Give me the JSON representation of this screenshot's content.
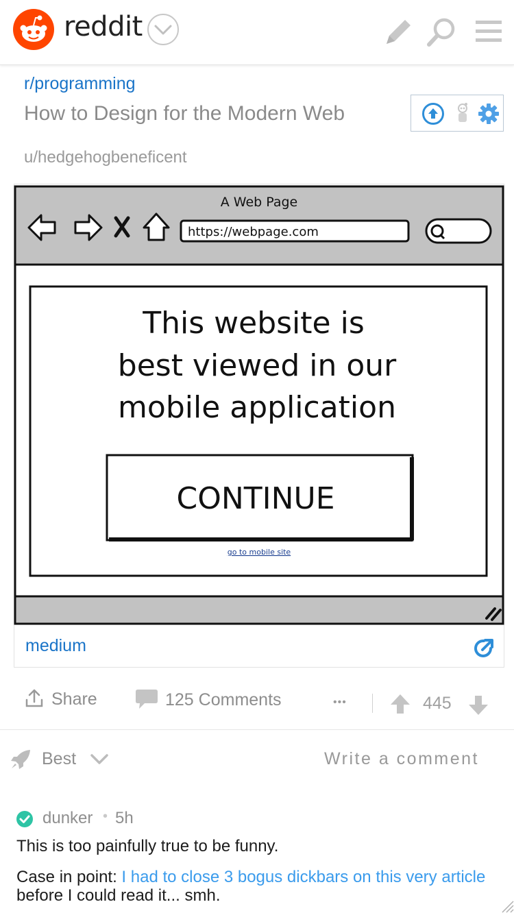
{
  "header": {
    "brand": "reddit",
    "icons": [
      "reddit-logo-icon",
      "chevron-down-icon",
      "pencil-icon",
      "search-icon",
      "menu-icon"
    ]
  },
  "post": {
    "subreddit": "r/programming",
    "title": "How to Design for the Modern Web",
    "author": "u/hedgehogbeneficent",
    "action_icons": [
      "upvote-circle-icon",
      "snoo-icon",
      "gear-icon"
    ]
  },
  "media": {
    "window_title": "A Web Page",
    "url": "https://webpage.com",
    "headline_lines": [
      "This website is",
      "best viewed in our",
      "mobile application"
    ],
    "continue_label": "CONTINUE",
    "mobile_link": "go to mobile site",
    "domain": "medium",
    "external_icon": "external-link-icon"
  },
  "actions": {
    "share_label": "Share",
    "comments_label": "125 Comments",
    "more_label": "•••",
    "score": "445"
  },
  "comments": {
    "sort_label": "Best",
    "write_label": "Write a comment",
    "items": [
      {
        "user": "dunker",
        "separator": "•",
        "time": "5h",
        "line1": "This is too painfully true to be funny.",
        "line2_prefix": "Case in point: ",
        "line2_link": "I had to close 3 bogus dickbars on this very article",
        "line2_suffix": " before I could read it... smh."
      }
    ]
  },
  "colors": {
    "brand_orange": "#ff4500",
    "link_blue": "#1a74c8",
    "muted_gray": "#8d8d8d",
    "online_green": "#2ec4a5"
  }
}
